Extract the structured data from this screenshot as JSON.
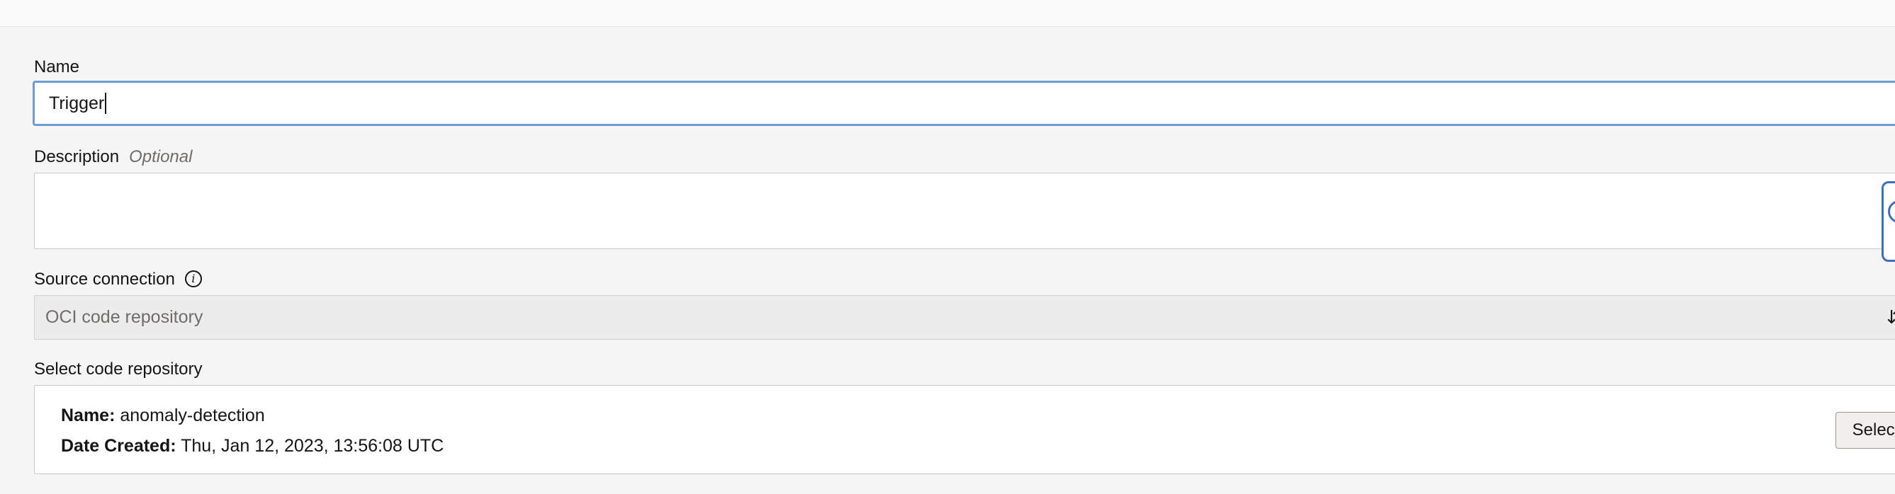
{
  "form": {
    "name_label": "Name",
    "name_value": "Trigger",
    "description_label": "Description",
    "description_optional": "Optional",
    "description_value": "",
    "source_connection_label": "Source connection",
    "source_connection_value": "OCI code repository",
    "code_repository_label": "Select code repository"
  },
  "repository": {
    "name_key": "Name:",
    "name_value": "anomaly-detection",
    "date_key": "Date Created:",
    "date_value": "Thu, Jan 12, 2023, 13:56:08 UTC",
    "select_button_label": "Select"
  },
  "icons": {
    "info": "info-icon",
    "updown": "select-updown-icon",
    "floating": "help-float-icon"
  },
  "colors": {
    "focus_border": "#6f9bd6",
    "page_background": "#f5f5f5",
    "disabled_select": "#ececec"
  }
}
